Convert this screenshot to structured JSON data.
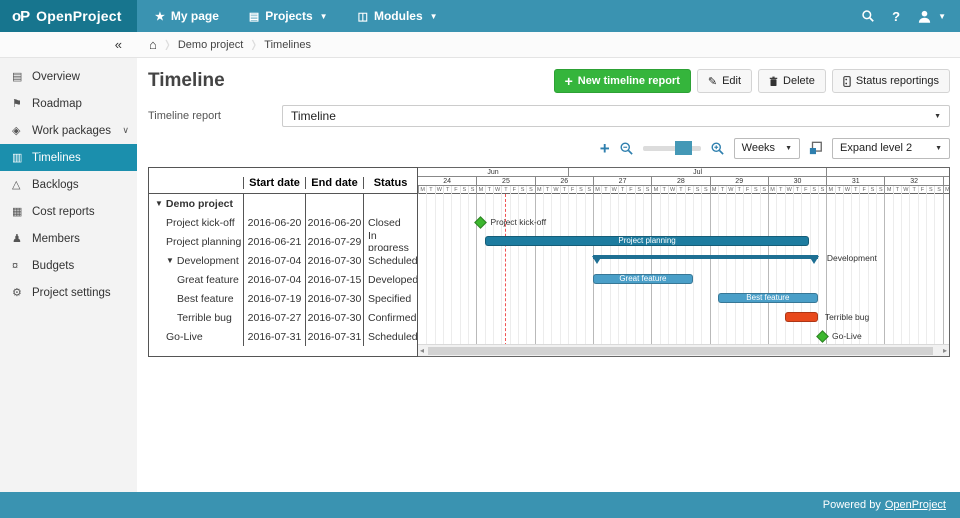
{
  "app": {
    "logo_mark": "oP",
    "logo_text": "OpenProject"
  },
  "top_nav": {
    "my_page": {
      "label": "My page"
    },
    "projects": {
      "label": "Projects"
    },
    "modules": {
      "label": "Modules"
    },
    "help_label": "?"
  },
  "breadcrumb": {
    "collapse": "«",
    "items": [
      "Demo project",
      "Timelines"
    ]
  },
  "sidebar": {
    "items": [
      {
        "label": "Overview",
        "icon": "overview-icon"
      },
      {
        "label": "Roadmap",
        "icon": "roadmap-icon"
      },
      {
        "label": "Work packages",
        "icon": "work-packages-icon",
        "chevron": true
      },
      {
        "label": "Timelines",
        "icon": "timelines-icon",
        "active": true
      },
      {
        "label": "Backlogs",
        "icon": "backlogs-icon"
      },
      {
        "label": "Cost reports",
        "icon": "cost-reports-icon"
      },
      {
        "label": "Members",
        "icon": "members-icon"
      },
      {
        "label": "Budgets",
        "icon": "budgets-icon"
      },
      {
        "label": "Project settings",
        "icon": "project-settings-icon"
      }
    ]
  },
  "main": {
    "title": "Timeline",
    "buttons": {
      "new_report": "New timeline report",
      "edit": "Edit",
      "delete": "Delete",
      "status_reportings": "Status reportings"
    },
    "timeline_report_label": "Timeline report",
    "timeline_report_value": "Timeline",
    "toolbar": {
      "zoom_unit": "Weeks",
      "expand": "Expand level 2"
    }
  },
  "table": {
    "headers": [
      "",
      "Start date",
      "End date",
      "Status"
    ],
    "rows": [
      {
        "name": "Demo project",
        "indent": 0,
        "arrow": true,
        "bold": true,
        "start": "",
        "end": "",
        "status": ""
      },
      {
        "name": "Project kick-off",
        "indent": 1,
        "start": "2016-06-20",
        "end": "2016-06-20",
        "status": "Closed"
      },
      {
        "name": "Project planning",
        "indent": 1,
        "start": "2016-06-21",
        "end": "2016-07-29",
        "status": "In progress"
      },
      {
        "name": "Development",
        "indent": 1,
        "arrow": true,
        "start": "2016-07-04",
        "end": "2016-07-30",
        "status": "Scheduled"
      },
      {
        "name": "Great feature",
        "indent": 2,
        "start": "2016-07-04",
        "end": "2016-07-15",
        "status": "Developed"
      },
      {
        "name": "Best feature",
        "indent": 2,
        "start": "2016-07-19",
        "end": "2016-07-30",
        "status": "Specified"
      },
      {
        "name": "Terrible bug",
        "indent": 2,
        "start": "2016-07-27",
        "end": "2016-07-30",
        "status": "Confirmed"
      },
      {
        "name": "Go-Live",
        "indent": 1,
        "start": "2016-07-31",
        "end": "2016-07-31",
        "status": "Scheduled"
      }
    ]
  },
  "chart_data": {
    "type": "gantt",
    "timeline_start": "2016-06-13",
    "day_width": 8.33,
    "weeks_start_num": 24,
    "weeks_count": 10,
    "day_letters": [
      "M",
      "T",
      "W",
      "T",
      "F",
      "S",
      "S"
    ],
    "months": [
      {
        "label": "Jun",
        "start": "2016-06-13",
        "end": "2016-06-30"
      },
      {
        "label": "Jul",
        "start": "2016-07-01",
        "end": "2016-07-31"
      },
      {
        "label": "",
        "start": "2016-08-01",
        "end": "2016-08-15"
      }
    ],
    "today": "2016-06-23",
    "items": [
      {
        "name": "Demo project",
        "type": "group"
      },
      {
        "name": "Project kick-off",
        "type": "milestone",
        "date": "2016-06-20",
        "color": "#3cb72e",
        "label": "outside"
      },
      {
        "name": "Project planning",
        "type": "bar",
        "start": "2016-06-21",
        "end": "2016-07-29",
        "color": "#1d7ca0",
        "label": "inside"
      },
      {
        "name": "Development",
        "type": "summary",
        "start": "2016-07-04",
        "end": "2016-07-30",
        "color": "#1d6f93",
        "label": "outside"
      },
      {
        "name": "Great feature",
        "type": "bar",
        "start": "2016-07-04",
        "end": "2016-07-15",
        "color": "#4a9fc8",
        "label": "inside"
      },
      {
        "name": "Best feature",
        "type": "bar",
        "start": "2016-07-19",
        "end": "2016-07-30",
        "color": "#4a9fc8",
        "label": "inside"
      },
      {
        "name": "Terrible bug",
        "type": "bar",
        "start": "2016-07-27",
        "end": "2016-07-30",
        "color": "#e8491c",
        "label": "outside"
      },
      {
        "name": "Go-Live",
        "type": "milestone",
        "date": "2016-07-31",
        "color": "#3cb72e",
        "label": "outside"
      }
    ]
  },
  "footer": {
    "powered_by": "Powered by",
    "link": "OpenProject"
  },
  "colors": {
    "header": "#3a93b1",
    "logo_bg": "#17758e",
    "active_item": "#1b8fad",
    "green_button": "#35b53c",
    "bar_dark": "#1d7ca0",
    "bar_light": "#4a9fc8",
    "bar_red": "#e8491c",
    "milestone_green": "#3cb72e",
    "today_line": "#f05353"
  }
}
